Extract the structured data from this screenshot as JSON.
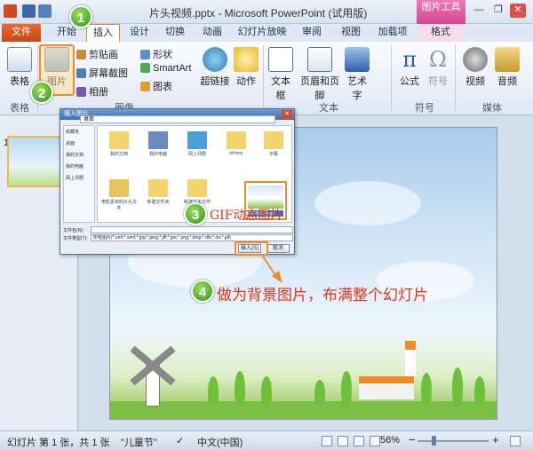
{
  "window": {
    "title": "片头视频.pptx - Microsoft PowerPoint (试用版)",
    "context_tab_group": "图片工具",
    "minimize": "—",
    "restore": "❐",
    "close": "✕"
  },
  "tabs": [
    "文件",
    "开始",
    "插入",
    "设计",
    "切换",
    "动画",
    "幻灯片放映",
    "审阅",
    "视图",
    "加载项",
    "格式"
  ],
  "ribbon": {
    "table": "表格",
    "picture": "图片",
    "clipart": "剪贴画",
    "screenshot": "屏幕截图",
    "album": "相册",
    "shapes": "形状",
    "smartart": "SmartArt",
    "chart": "图表",
    "hyperlink": "超链接",
    "action": "动作",
    "textbox": "文本框",
    "header_footer": "页眉和页脚",
    "wordart": "艺术字",
    "formula": "公式",
    "symbol": "符号",
    "video": "视频",
    "audio": "音频",
    "groups": {
      "table": "表格",
      "image": "图像",
      "text": "文本",
      "symbols": "符号",
      "media": "媒体"
    }
  },
  "dialog": {
    "title": "插入图片",
    "path": "桌面",
    "nav": [
      "收藏夹",
      "桌面",
      "我的文档",
      "我的电脑",
      "网上邻居"
    ],
    "files": [
      "我的文档",
      "我的电脑",
      "网上邻居",
      "nrfsery",
      "字幕",
      "电影素材的片头文件",
      "新建文件夹",
      "新建文本文件",
      "GIF动态图.gif"
    ],
    "filename_label": "文件名(N):",
    "filetype_label": "文件类型(T):",
    "filetype_value": "所有图片(*.emf;*.wmf;*.jpg;*.jpeg;*.jfif;*.jpe;*.png;*.bmp;*.dib;*.rle;*.gif)",
    "insert_button": "插入(S)",
    "cancel_button": "取消"
  },
  "annotations": {
    "step1": "1",
    "step2": "2",
    "step3": "3",
    "step4": "4",
    "gif_note": "GIF动态图片",
    "background_note": "做为背景图片，布满整个幻灯片"
  },
  "slides_pane": {
    "slide_number": "1"
  },
  "status": {
    "slide_info": "幻灯片 第 1 张，共 1 张",
    "theme": "\"儿童节\"",
    "language": "中文(中国)",
    "zoom": "56%"
  },
  "colors": {
    "accent": "#e0341c",
    "file_tab": "#d05a24",
    "highlight": "#f08a2b"
  }
}
